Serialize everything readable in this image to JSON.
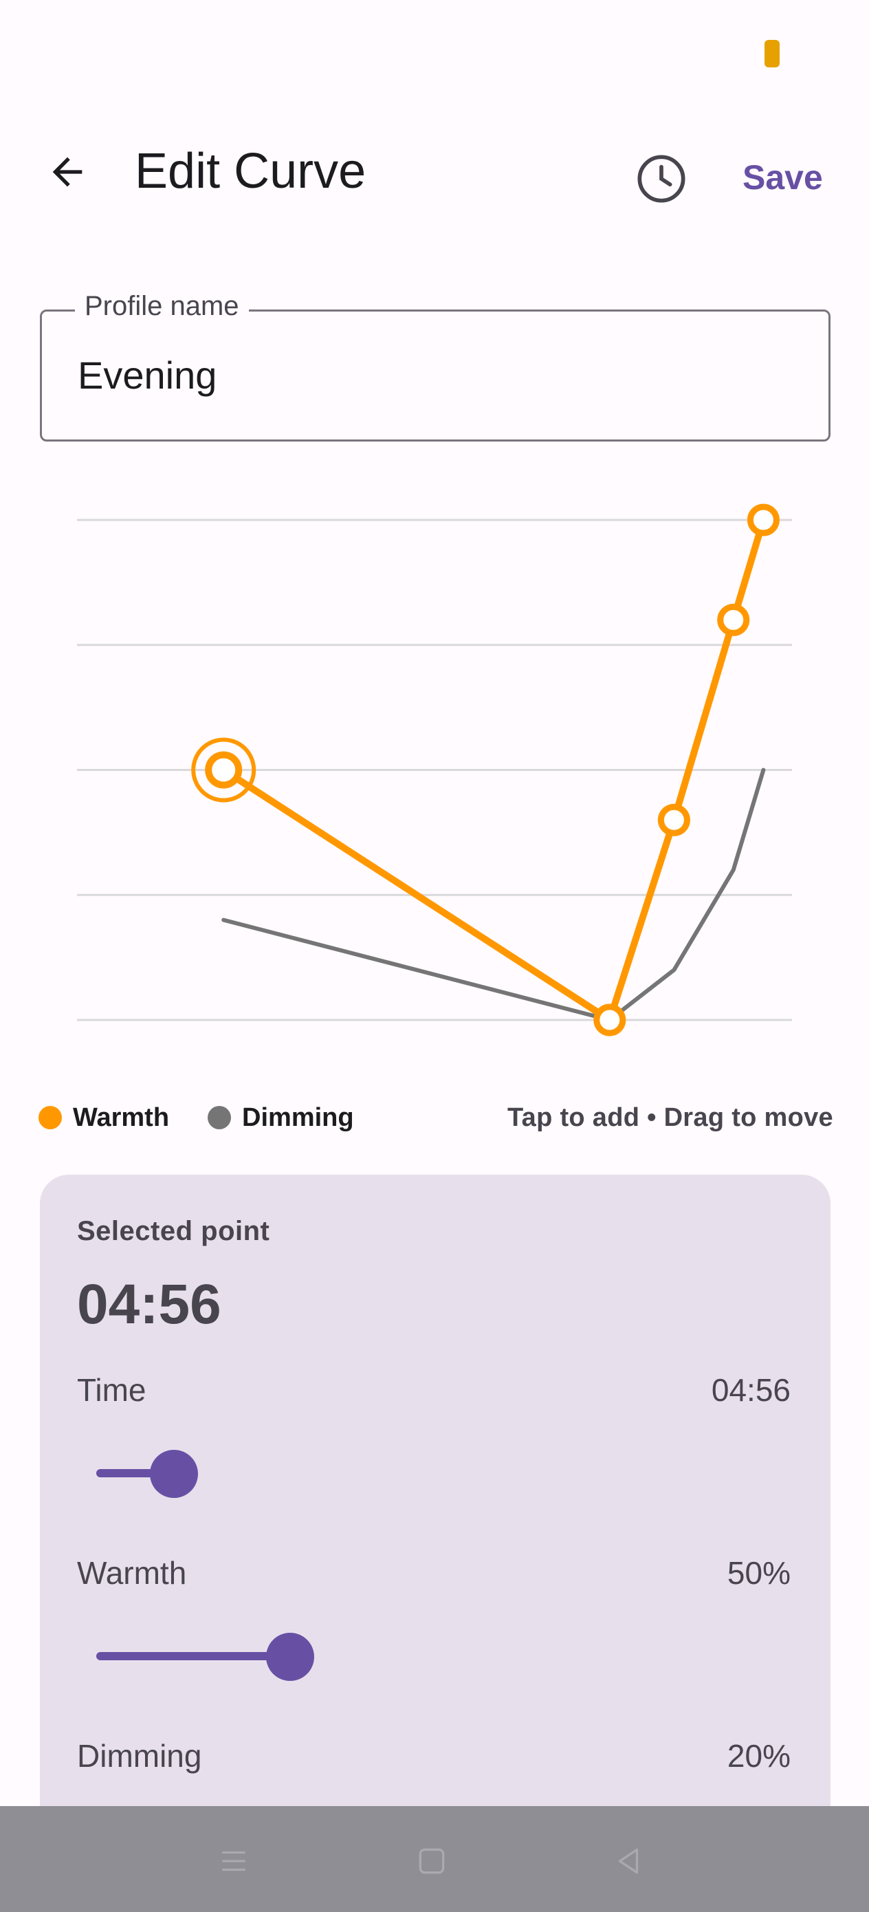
{
  "colors": {
    "accent": "#6750a4",
    "warmth": "#ff9800",
    "dimming": "#757575",
    "panel": "#e7e0ec"
  },
  "app_bar": {
    "title": "Edit Curve",
    "back_icon": "arrow-back-icon",
    "history_icon": "clock-icon",
    "save_label": "Save"
  },
  "profile": {
    "label": "Profile name",
    "value": "Evening"
  },
  "chart_data": {
    "type": "line",
    "grid": true,
    "ylim": [
      0,
      100
    ],
    "series": [
      {
        "name": "Warmth",
        "color": "#ff9800",
        "points": [
          {
            "x": 0.205,
            "y": 50,
            "selected": true
          },
          {
            "x": 0.745,
            "y": 0
          },
          {
            "x": 0.835,
            "y": 40
          },
          {
            "x": 0.918,
            "y": 80
          },
          {
            "x": 0.96,
            "y": 100
          }
        ]
      },
      {
        "name": "Dimming",
        "color": "#757575",
        "points": [
          {
            "x": 0.205,
            "y": 20
          },
          {
            "x": 0.745,
            "y": 0
          },
          {
            "x": 0.835,
            "y": 10
          },
          {
            "x": 0.918,
            "y": 30
          },
          {
            "x": 0.96,
            "y": 50
          }
        ]
      }
    ]
  },
  "legend": {
    "warmth_label": "Warmth",
    "dimming_label": "Dimming",
    "hint": "Tap to add • Drag to move"
  },
  "panel": {
    "caption": "Selected point",
    "time": "04:56",
    "rows": [
      {
        "label": "Time",
        "value": "04:56",
        "level": 0.2
      },
      {
        "label": "Warmth",
        "value": "50%",
        "level": 0.5
      },
      {
        "label": "Dimming",
        "value": "20%"
      }
    ]
  },
  "nav": {
    "menu_icon": "menu-icon",
    "home_icon": "home-icon",
    "back_icon": "back-triangle-icon"
  }
}
